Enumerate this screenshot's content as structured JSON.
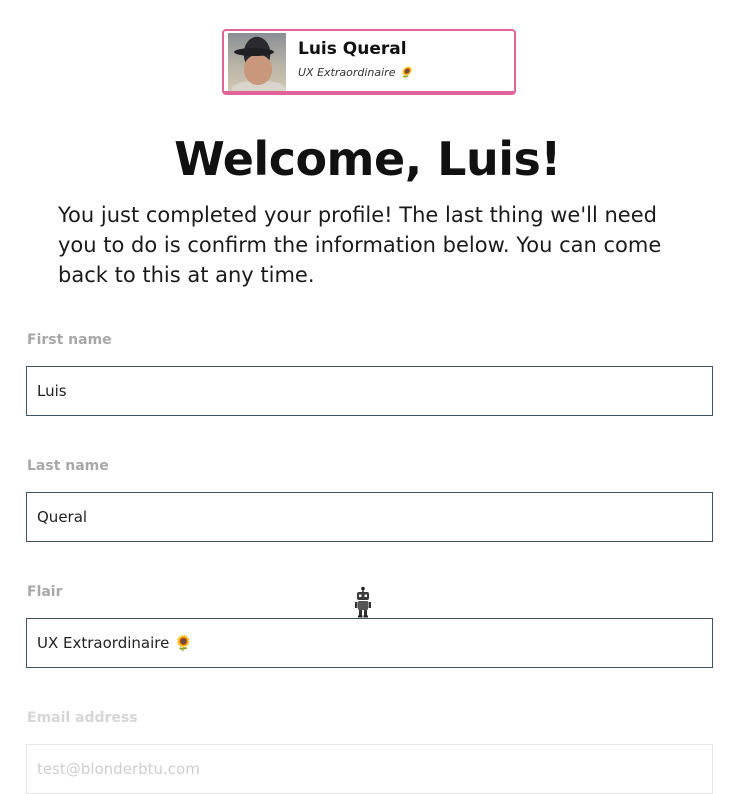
{
  "profile_card": {
    "name": "Luis Queral",
    "flair": "UX Extraordinaire 🌻"
  },
  "welcome": {
    "title": "Welcome, Luis!",
    "intro": "You just completed your profile! The last thing we'll need you to do is confirm the information below. You can come back to this at any time."
  },
  "form": {
    "first_name": {
      "label": "First name",
      "value": "Luis"
    },
    "last_name": {
      "label": "Last name",
      "value": "Queral"
    },
    "flair": {
      "label": "Flair",
      "value": "UX Extraordinaire 🌻"
    },
    "email": {
      "label": "Email address",
      "value": "test@blonderbtu.com"
    }
  },
  "colors": {
    "card_border": "#e0649a",
    "input_border": "#3f5566",
    "label_text": "#a8a8a8"
  },
  "icons": {
    "robot": "robot-icon"
  }
}
